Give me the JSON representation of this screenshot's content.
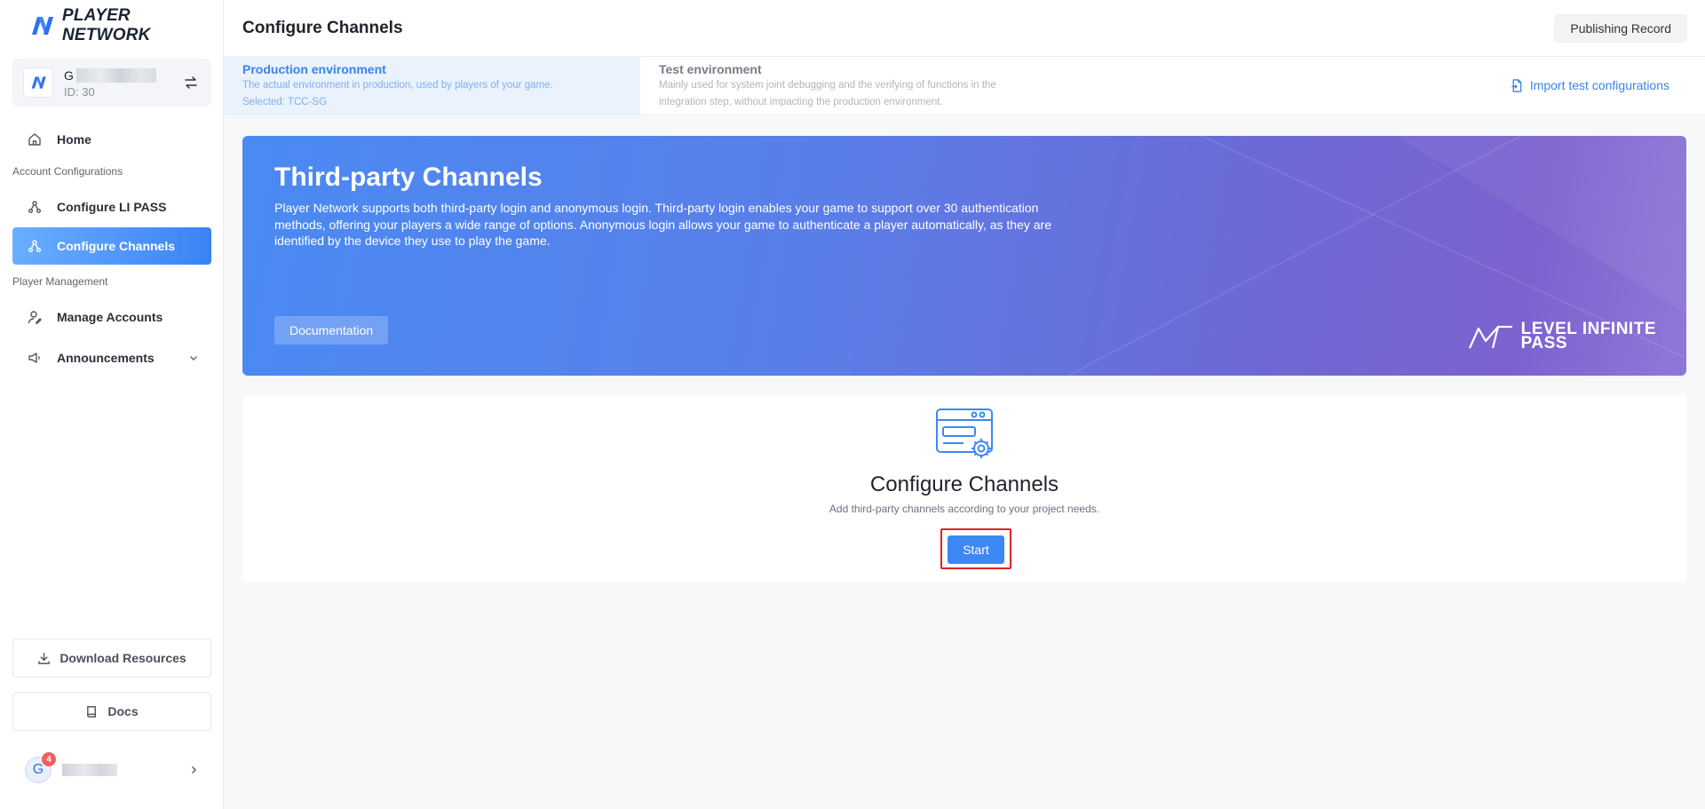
{
  "brand": {
    "name": "PLAYER NETWORK"
  },
  "project": {
    "name_initial": "G",
    "id_label": "ID: 30"
  },
  "nav": {
    "home": "Home",
    "section_account": "Account Configurations",
    "configure_li_pass": "Configure LI PASS",
    "configure_channels": "Configure Channels",
    "section_player": "Player Management",
    "manage_accounts": "Manage Accounts",
    "announcements": "Announcements"
  },
  "sidebar_bottom": {
    "download_resources": "Download Resources",
    "docs": "Docs",
    "avatar_initial": "G",
    "notification_count": "4"
  },
  "header": {
    "title": "Configure Channels",
    "publishing_record": "Publishing Record"
  },
  "environments": {
    "production": {
      "title": "Production environment",
      "desc": "The actual environment in production, used by players of your game.",
      "selected": "Selected: TCC-SG"
    },
    "test": {
      "title": "Test environment",
      "desc_line1": "Mainly used for system joint debugging and the verifying of functions in the",
      "desc_line2": "integration step, without impacting the production environment."
    },
    "import_link": "Import test configurations"
  },
  "banner": {
    "title": "Third-party Channels",
    "desc_line1": "Player Network supports both third-party login and anonymous login. Third-party login enables your game to support over 30 authentication",
    "desc_line2": "methods, offering your players a wide range of options. Anonymous login allows your game to authenticate a player automatically, as they are",
    "desc_line3": "identified by the device they use to play the game.",
    "doc_button": "Documentation",
    "logo_line1": "LEVEL INFINITE",
    "logo_line2": "PASS"
  },
  "empty_state": {
    "title": "Configure Channels",
    "subtitle": "Add third-party channels according to your project needs.",
    "start_button": "Start"
  },
  "colors": {
    "accent": "#3d88f4",
    "active_nav_start": "#6aaeff",
    "active_nav_end": "#3b82f6",
    "banner_start": "#4a8af3",
    "banner_end": "#9077d6",
    "highlight": "#e02424",
    "badge": "#f25e5e"
  },
  "icons": {
    "home": "home-icon",
    "channels": "branch-icon",
    "manage_accounts": "user-edit-icon",
    "announcements": "speaker-icon",
    "download": "download-icon",
    "docs": "book-icon",
    "import": "file-import-icon",
    "switch": "swap-icon"
  }
}
